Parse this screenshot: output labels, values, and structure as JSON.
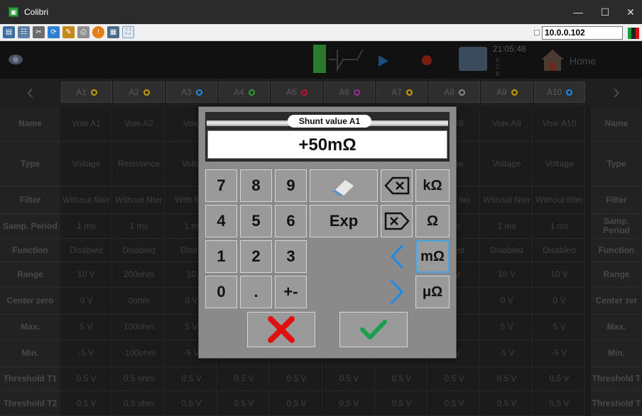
{
  "window": {
    "title": "Colibri",
    "minimize": "—",
    "maximize": "☐",
    "close": "✕"
  },
  "toolbar": {
    "icons": [
      "app-screen-icon",
      "tree-icon",
      "tools-icon",
      "refresh-icon",
      "paint-icon",
      "print-icon",
      "alert-icon",
      "network-icon",
      "fullscreen-icon"
    ],
    "ip_address": "10.0.0.102"
  },
  "appbar": {
    "clock": "21:05:48",
    "clock_sub": "A C B O",
    "home_label": "Home"
  },
  "channels": [
    "A1",
    "A2",
    "A3",
    "A4",
    "A5",
    "A6",
    "A7",
    "A8",
    "A9",
    "A10"
  ],
  "rows": [
    {
      "label": "Name",
      "values": [
        "Voie A1",
        "Voie A2",
        "Voie",
        "",
        "",
        "",
        "",
        "ie A8",
        "Voie A9",
        "Voie A10"
      ]
    },
    {
      "label": "Type",
      "values": [
        "Voltage",
        "Resistance",
        "Volta",
        "",
        "",
        "",
        "",
        "ltage",
        "Voltage",
        "Voltage"
      ]
    },
    {
      "label": "Filter",
      "values": [
        "Without filter",
        "Without filter",
        "With filte",
        "",
        "",
        "",
        "",
        "thout lter",
        "Without filter",
        "Without filter"
      ]
    },
    {
      "label": "Samp. Period",
      "values": [
        "1 ms",
        "1 ms",
        "1 m",
        "",
        "",
        "",
        "",
        "ms",
        "1 ms",
        "1 ms"
      ]
    },
    {
      "label": "Function",
      "values": [
        "Disabled",
        "Disabled",
        "Disab",
        "",
        "",
        "",
        "",
        "abled",
        "Disabled",
        "Disabled"
      ]
    },
    {
      "label": "Range",
      "values": [
        "10 V",
        "200ohm",
        "10",
        "",
        "",
        "",
        "",
        "0 V",
        "10 V",
        "10 V"
      ]
    },
    {
      "label": "Center zero",
      "values": [
        "0 V",
        "0ohm",
        "0 V",
        "",
        "",
        "",
        "",
        "V",
        "0 V",
        "0 V"
      ]
    },
    {
      "label": "Max.",
      "values": [
        "5 V",
        "100ohm",
        "5 V",
        "",
        "",
        "",
        "",
        "V",
        "5 V",
        "5 V"
      ]
    },
    {
      "label": "Min.",
      "values": [
        "-5 V",
        "-100ohm",
        "-5 V",
        "",
        "",
        "",
        "",
        "5 V",
        "-5 V",
        "-5 V"
      ]
    },
    {
      "label": "Threshold T1",
      "values": [
        "0.5 V",
        "0.5 ohm",
        "0.5 V",
        "0.5 V",
        "0.5 V",
        "0.5 V",
        "0.5 V",
        "0.5 V",
        "0.5 V",
        "0.5 V"
      ]
    },
    {
      "label": "Threshold T2",
      "values": [
        "0.5 V",
        "0.5 ohm",
        "0.5 V",
        "0.5 V",
        "0.5 V",
        "0.5 V",
        "0.5 V",
        "0.5 V",
        "0.5 V",
        "0.5 V"
      ]
    }
  ],
  "right_labels": [
    "Name",
    "Type",
    "Filter",
    "Samp. Period",
    "Function",
    "Range",
    "Center zer",
    "Max.",
    "Min.",
    "Threshold T",
    "Threshold T"
  ],
  "dialog": {
    "title": "Shunt value A1",
    "value": "+50mΩ",
    "keys": {
      "k7": "7",
      "k8": "8",
      "k9": "9",
      "k4": "4",
      "k5": "5",
      "k6": "6",
      "exp": "Exp",
      "k1": "1",
      "k2": "2",
      "k3": "3",
      "k0": "0",
      "dot": ".",
      "plusminus": "+-",
      "kohm": "kΩ",
      "ohm": "Ω",
      "mohm": "mΩ",
      "uohm": "μΩ"
    },
    "selected_unit": "mΩ",
    "colors": {
      "accent": "#1e8ae6",
      "cancel": "#e01010",
      "ok": "#1aa04a"
    }
  }
}
